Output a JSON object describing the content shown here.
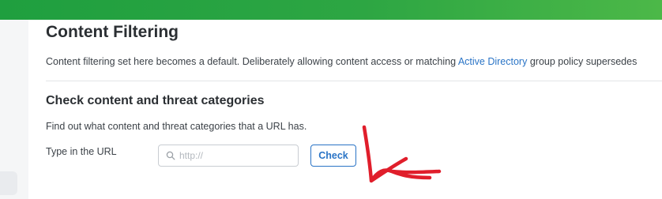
{
  "page": {
    "title": "Content Filtering",
    "description_before_link": "Content filtering set here becomes a default. Deliberately allowing content access or matching ",
    "description_link": "Active Directory",
    "description_after_link": " group policy supersedes"
  },
  "check_section": {
    "title": "Check content and threat categories",
    "description": "Find out what content and threat categories that a URL has.",
    "url_label": "Type in the URL",
    "url_placeholder": "http://",
    "url_value": "",
    "check_button_label": "Check"
  },
  "colors": {
    "brand_green": "#2da643",
    "link_blue": "#2a74c6",
    "annotation_red": "#e01e2b"
  },
  "icons": {
    "url_field_icon": "search-icon"
  }
}
